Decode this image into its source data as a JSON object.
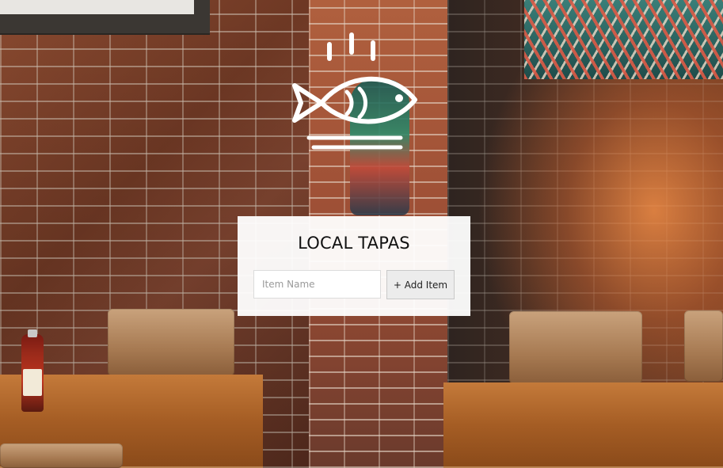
{
  "card": {
    "title": "LOCAL TAPAS",
    "input_placeholder": "Item Name",
    "input_value": "",
    "add_button_label": "+ Add Item"
  },
  "logo": {
    "icon": "fish-steam-icon",
    "color": "#ffffff"
  },
  "colors": {
    "card_bg": "#ffffff",
    "button_bg": "#ececec",
    "text": "#111111"
  }
}
